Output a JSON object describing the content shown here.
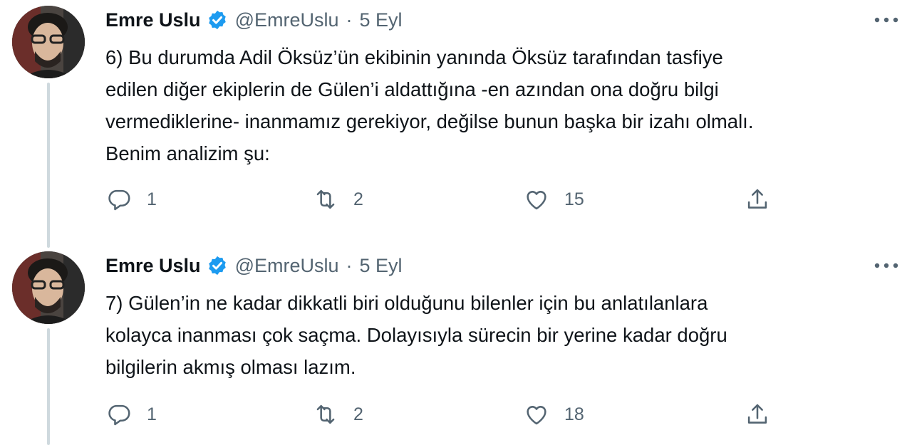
{
  "tweets": [
    {
      "author_name": "Emre Uslu",
      "handle": "@EmreUslu",
      "separator": "·",
      "time": "5 Eyl",
      "text": "6) Bu durumda Adil Öksüz’ün ekibinin yanında Öksüz tarafından tasfiye\nedilen diğer ekiplerin de Gülen’i aldattığına -en azından ona doğru bilgi\nvermediklerine- inanmamız gerekiyor, değilse bunun başka bir izahı olmalı.\nBenim analizim şu:",
      "replies": "1",
      "retweets": "2",
      "likes": "15"
    },
    {
      "author_name": "Emre Uslu",
      "handle": "@EmreUslu",
      "separator": "·",
      "time": "5 Eyl",
      "text": "7) Gülen’in ne kadar dikkatli biri olduğunu bilenler için bu anlatılanlara\nkolayca inanması çok saçma. Dolayısıyla sürecin bir yerine kadar doğru\nbilgilerin akmış olması lazım.",
      "replies": "1",
      "retweets": "2",
      "likes": "18"
    }
  ],
  "icons": {
    "verified": "verified-badge-icon",
    "more": "more-horizontal-icon",
    "reply": "reply-icon",
    "retweet": "retweet-icon",
    "like": "like-icon",
    "share": "share-icon"
  },
  "colors": {
    "verified_blue": "#1d9bf0",
    "secondary_text": "#536471",
    "thread_line": "#cfd9de"
  }
}
